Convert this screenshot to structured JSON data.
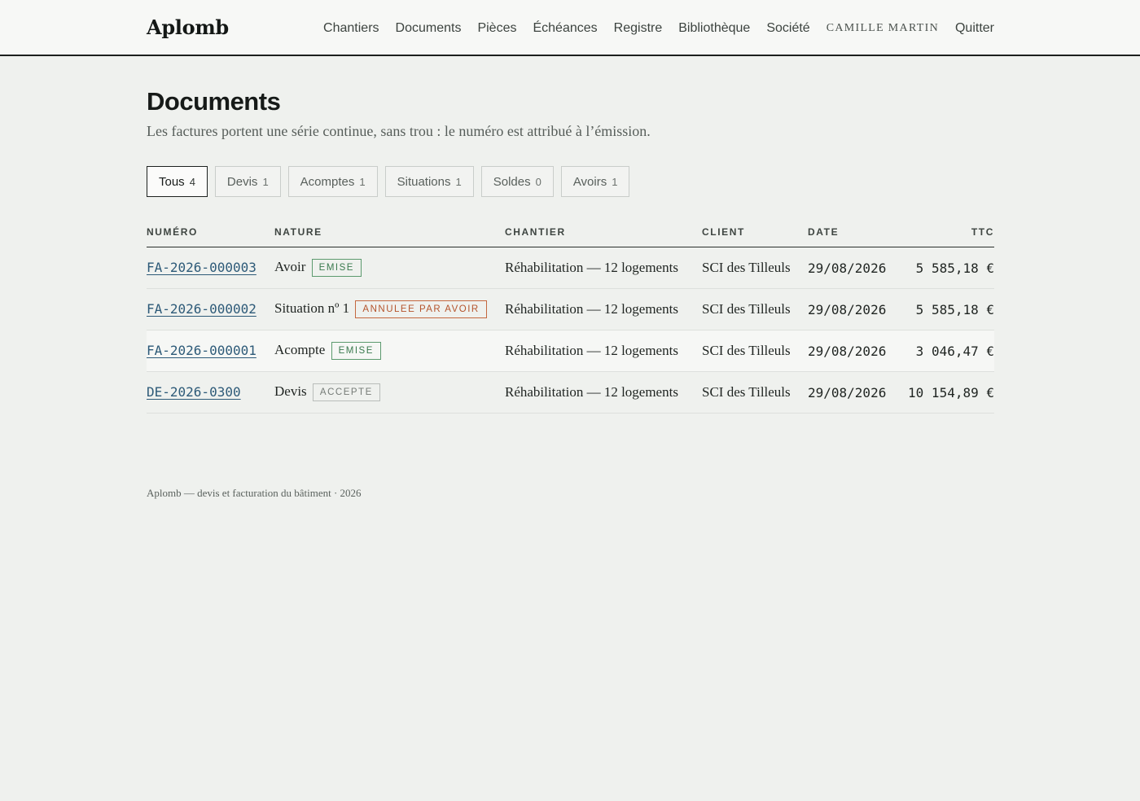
{
  "header": {
    "brand": "Aplomb",
    "nav": [
      "Chantiers",
      "Documents",
      "Pièces",
      "Échéances",
      "Registre",
      "Bibliothèque",
      "Société"
    ],
    "user": "CAMILLE MARTIN",
    "logout": "Quitter"
  },
  "page": {
    "title": "Documents",
    "subtitle": "Les factures portent une série continue, sans trou : le numéro est attribué à l’émission."
  },
  "filters": [
    {
      "label": "Tous",
      "count": "4",
      "active": true
    },
    {
      "label": "Devis",
      "count": "1"
    },
    {
      "label": "Acomptes",
      "count": "1"
    },
    {
      "label": "Situations",
      "count": "1"
    },
    {
      "label": "Soldes",
      "count": "0"
    },
    {
      "label": "Avoirs",
      "count": "1"
    }
  ],
  "table": {
    "headers": {
      "numero": "NUMÉRO",
      "nature": "NATURE",
      "chantier": "CHANTIER",
      "client": "CLIENT",
      "date": "DATE",
      "ttc": "TTC"
    },
    "rows": [
      {
        "numero": "FA-2026-000003",
        "nature": "Avoir",
        "badge": "EMISE",
        "badge_color": "#3a7a4e",
        "chantier": "Réhabilitation — 12 logements",
        "client": "SCI des Tilleuls",
        "date": "29/08/2026",
        "ttc": "5 585,18 €"
      },
      {
        "numero": "FA-2026-000002",
        "nature": "Situation nº 1",
        "badge": "ANNULEE PAR AVOIR",
        "badge_color": "#b5542c",
        "chantier": "Réhabilitation — 12 logements",
        "client": "SCI des Tilleuls",
        "date": "29/08/2026",
        "ttc": "5 585,18 €"
      },
      {
        "numero": "FA-2026-000001",
        "nature": "Acompte",
        "badge": "EMISE",
        "badge_color": "#3a7a4e",
        "chantier": "Réhabilitation — 12 logements",
        "client": "SCI des Tilleuls",
        "date": "29/08/2026",
        "ttc": "3 046,47 €"
      },
      {
        "numero": "DE-2026-0300",
        "nature": "Devis",
        "badge": "ACCEPTE",
        "badge_color": "#757b77",
        "chantier": "Réhabilitation — 12 logements",
        "client": "SCI des Tilleuls",
        "date": "29/08/2026",
        "ttc": "10 154,89 €"
      }
    ]
  },
  "footer": {
    "text": "Aplomb — devis et facturation du bâtiment · 2026"
  }
}
